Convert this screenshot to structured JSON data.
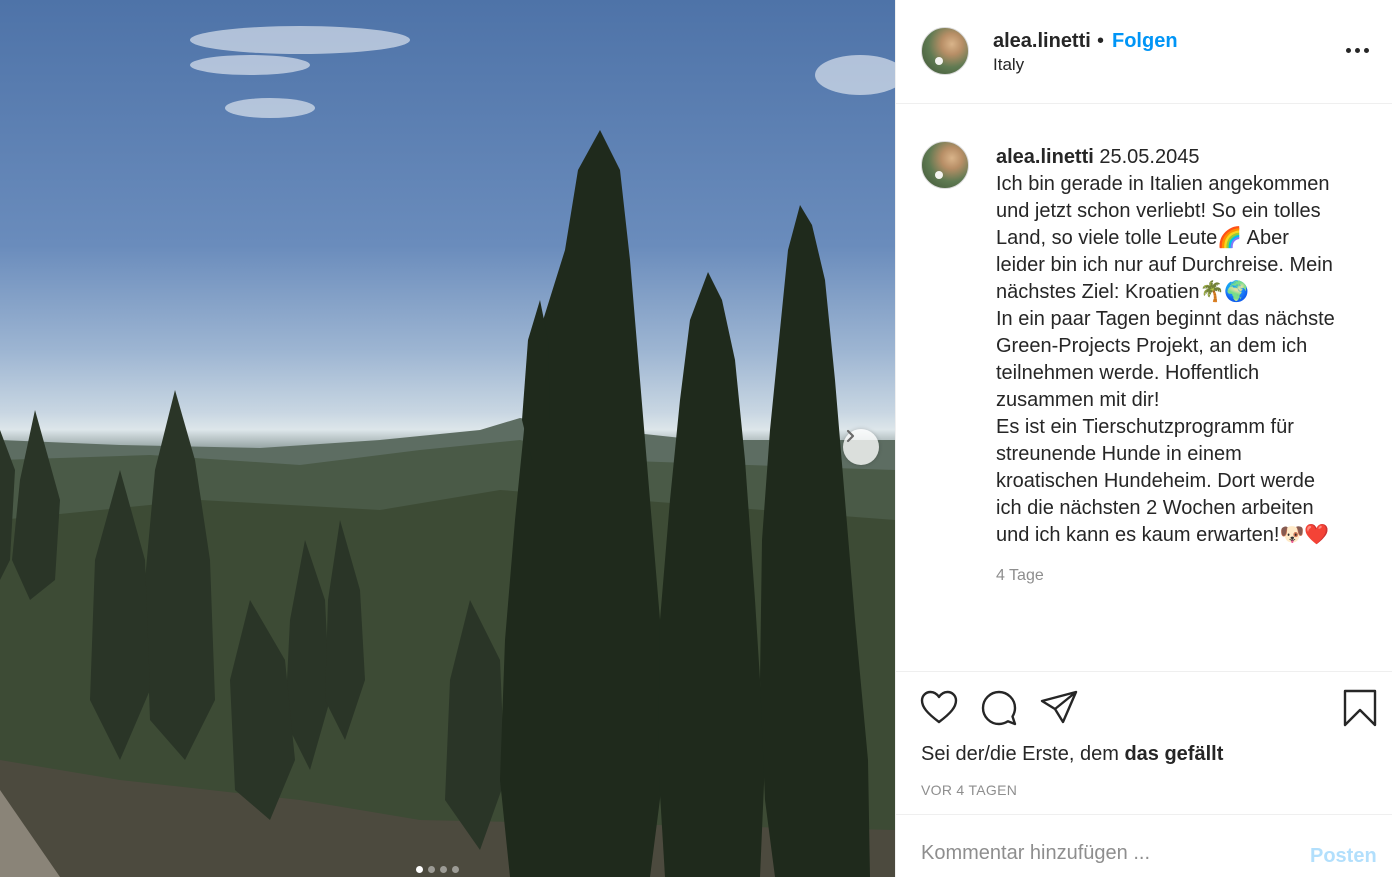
{
  "post": {
    "username": "alea.linetti",
    "separator": "•",
    "follow_label": "Folgen",
    "location": "Italy",
    "more_icon": "more-horizontal-icon",
    "caption": {
      "username": "alea.linetti",
      "date": "25.05.2045",
      "text": "Ich bin gerade in Italien angekommen\nund jetzt schon verliebt! So ein tolles\nLand, so viele tolle Leute🌈 Aber\nleider bin ich nur auf Durchreise. Mein\nnächstes Ziel: Kroatien🌴🌍\nIn ein paar Tagen beginnt das nächste\nGreen-Projects Projekt, an dem ich\nteilnehmen werde. Hoffentlich\nzusammen mit dir!\nEs ist ein Tierschutzprogramm für\nstreunende Hunde in einem\nkroatischen Hundeheim. Dort werde\nich die nächsten 2 Wochen arbeiten\nund ich kann es kaum erwarten!🐶❤️",
      "age": "4 Tage"
    },
    "likes": {
      "prefix": "Sei der/die Erste, dem ",
      "bold": "das gefällt"
    },
    "timestamp": "VOR 4 TAGEN",
    "comment": {
      "placeholder": "Kommentar hinzufügen ...",
      "post_label": "Posten"
    },
    "carousel": {
      "slides": 4,
      "active": 0
    }
  },
  "colors": {
    "accent": "#0095f6",
    "post_disabled": "#b2dffc",
    "muted": "#8e8e8e",
    "text": "#262626"
  }
}
